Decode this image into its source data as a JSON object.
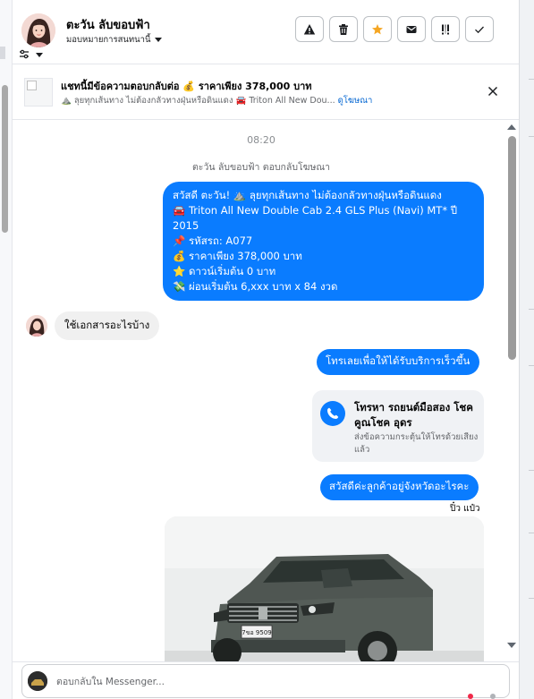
{
  "header": {
    "contact_name": "ตะวัน ลับขอบฟ้า",
    "assign_label": "มอบหมายการสนทนานี้",
    "actions": [
      {
        "name": "report-spam-button",
        "icon": "warning-icon"
      },
      {
        "name": "delete-button",
        "icon": "trash-icon"
      },
      {
        "name": "star-button",
        "icon": "star-icon"
      },
      {
        "name": "mark-unread-button",
        "icon": "envelope-icon"
      },
      {
        "name": "follow-up-button",
        "icon": "important-icon"
      },
      {
        "name": "mark-done-button",
        "icon": "check-icon"
      }
    ]
  },
  "ad": {
    "title": "แชทนี้มีข้อความตอบกลับต่อ 💰 ราคาเพียง 378,000 บาท",
    "subtitle": "⛰️ ลุยทุกเส้นทาง ไม่ต้องกลัวทางฝุ่นหรือดินแดง 🚘 Triton All New Dou...",
    "link": "ดูโฆษณา"
  },
  "chat": {
    "timestamp": "08:20",
    "reply_meta": "ตะวัน ลับขอบฟ้า ตอบกลับโฆษณา",
    "ad_reply_lines": [
      "สวัสดี ตะวัน! ⛰️ ลุยทุกเส้นทาง ไม่ต้องกลัวทางฝุ่นหรือดินแดง",
      "🚘 Triton All New Double Cab 2.4 GLS Plus (Navi) MT* ปี",
      "2015",
      "📌 รหัสรถ:  A077",
      "💰 ราคาเพียง 378,000 บาท",
      "⭐ ดาวน์เริ่มต้น 0 บาท",
      "💸 ผ่อนเริ่มต้น 6,xxx บาท x 84 งวด"
    ],
    "customer_message": "ใช้เอกสารอะไรบ้าง",
    "reply_call_prompt": "โทรเลยเพื่อให้ได้รับบริการเร็วขึ้น",
    "call_card": {
      "title": "โทรหา รถยนต์มือสอง โชคคูณโชค อุดร",
      "subtitle": "ส่งข้อความกระตุ้นให้โทรด้วยเสียงแล้ว"
    },
    "reply_province": "สวัสดีค่ะลูกค้าอยู่จังหวัดอะไรคะ",
    "sender_name": "ปิ๋ว แป๋ว",
    "plate_text": "7ขอ 9509"
  },
  "composer": {
    "placeholder": "ตอบกลับใน Messenger..."
  },
  "colors": {
    "bubble_blue": "#0a7cff",
    "incoming_bubble": "#f0f0f0",
    "link_blue": "#0064d1",
    "star_orange": "#f5a623"
  }
}
